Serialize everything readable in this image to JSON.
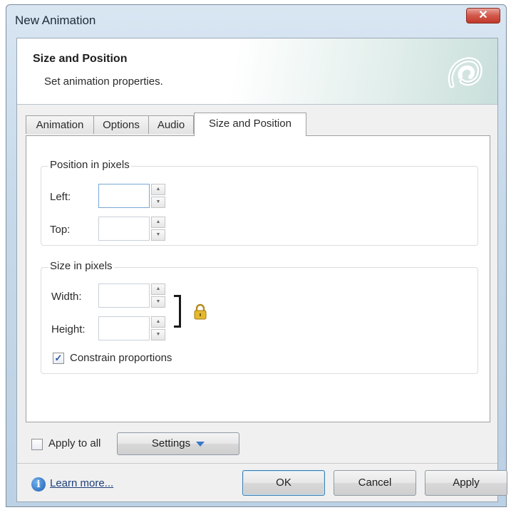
{
  "window": {
    "title": "New Animation",
    "close_glyph": "✕"
  },
  "header": {
    "title": "Size and Position",
    "subtitle": "Set animation properties.",
    "logo_icon": "app-logo-icon"
  },
  "tabs": [
    {
      "label": "Animation",
      "active": false
    },
    {
      "label": "Options",
      "active": false
    },
    {
      "label": "Audio",
      "active": false
    },
    {
      "label": "Size and Position",
      "active": true
    }
  ],
  "position_group": {
    "label": "Position in pixels",
    "left": {
      "label": "Left:",
      "value": ""
    },
    "top": {
      "label": "Top:",
      "value": ""
    }
  },
  "size_group": {
    "label": "Size in pixels",
    "width": {
      "label": "Width:",
      "value": ""
    },
    "height": {
      "label": "Height:",
      "value": ""
    },
    "constrain": {
      "label": "Constrain proportions",
      "checked": true
    }
  },
  "apply_all": {
    "label": "Apply to all",
    "checked": false
  },
  "settings_button": {
    "label": "Settings"
  },
  "footer": {
    "learn_more": "Learn more...",
    "ok": "OK",
    "cancel": "Cancel",
    "apply": "Apply"
  }
}
